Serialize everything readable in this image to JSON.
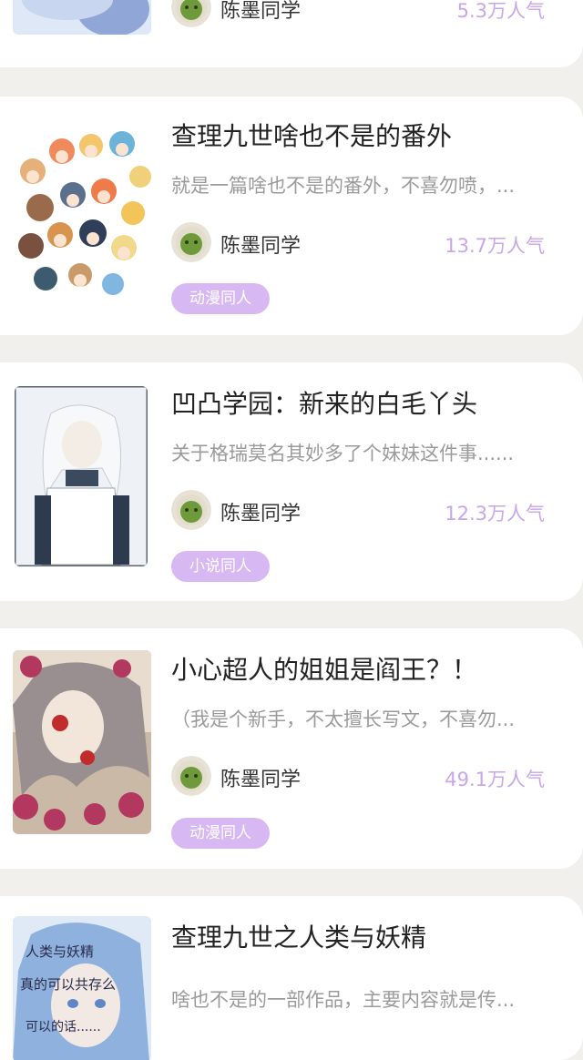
{
  "accent_color": "#c7a6ea",
  "tag_color": "#d7b8f2",
  "cards": [
    {
      "title": "",
      "description": "",
      "author": "陈墨同学",
      "popularity": "5.3万人气",
      "tag": "",
      "cover_icon": "partial-cover-image"
    },
    {
      "title": "查理九世啥也不是的番外",
      "description": "就是一篇啥也不是的番外，不喜勿喷，...",
      "author": "陈墨同学",
      "popularity": "13.7万人气",
      "tag": "动漫同人",
      "cover_icon": "chibi-characters-cover"
    },
    {
      "title": "凹凸学园：新来的白毛丫头",
      "description": "关于格瑞莫名其妙多了个妹妹这件事......",
      "author": "陈墨同学",
      "popularity": "12.3万人气",
      "tag": "小说同人",
      "cover_icon": "white-hair-character-cover"
    },
    {
      "title": "小心超人的姐姐是阎王？！",
      "description": "（我是个新手，不太擅长写文，不喜勿...",
      "author": "陈墨同学",
      "popularity": "49.1万人气",
      "tag": "动漫同人",
      "cover_icon": "red-eye-character-cover"
    },
    {
      "title": "查理九世之人类与妖精",
      "description": "啥也不是的一部作品，主要内容就是传...",
      "author": "",
      "popularity": "",
      "tag": "",
      "cover_icon": "blue-hair-character-cover",
      "cover_text": [
        "人类与妖精",
        "真的可以共存么",
        "可以的话......"
      ]
    }
  ]
}
